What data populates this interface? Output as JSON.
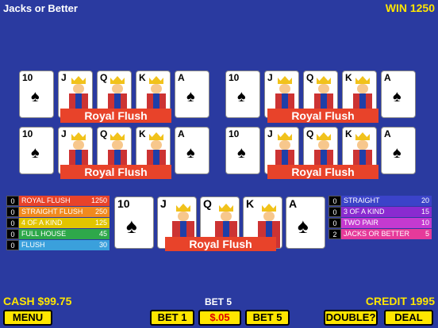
{
  "header": {
    "title": "Jacks or Better",
    "win": "WIN 1250"
  },
  "hands": {
    "banner": "Royal Flush",
    "cards": [
      {
        "rank": "10",
        "suit": "♠"
      },
      {
        "rank": "J",
        "suit": "♠"
      },
      {
        "rank": "Q",
        "suit": "♠"
      },
      {
        "rank": "K",
        "suit": "♠"
      },
      {
        "rank": "A",
        "suit": "♠"
      }
    ]
  },
  "paytable_left": [
    {
      "count": "0",
      "label": "ROYAL FLUSH",
      "value": "1250",
      "color": "#e8432a"
    },
    {
      "count": "0",
      "label": "STRAIGHT FLUSH",
      "value": "250",
      "color": "#f08a1f"
    },
    {
      "count": "0",
      "label": "4 OF A KIND",
      "value": "125",
      "color": "#e2c500"
    },
    {
      "count": "0",
      "label": "FULL HOUSE",
      "value": "45",
      "color": "#2ea84a"
    },
    {
      "count": "0",
      "label": "FLUSH",
      "value": "30",
      "color": "#3aa0dc"
    }
  ],
  "paytable_right": [
    {
      "count": "0",
      "label": "STRAIGHT",
      "value": "20",
      "color": "#3b43c9"
    },
    {
      "count": "0",
      "label": "3 OF A KIND",
      "value": "15",
      "color": "#8a2bd0"
    },
    {
      "count": "0",
      "label": "TWO PAIR",
      "value": "10",
      "color": "#c43ad0"
    },
    {
      "count": "2",
      "label": "JACKS OR BETTER",
      "value": "5",
      "color": "#e63a9a"
    }
  ],
  "footer": {
    "cash": "CASH $99.75",
    "credit": "CREDIT 1995",
    "bet": "BET 5",
    "menu": "MENU",
    "bet1": "BET 1",
    "denom": "$.05",
    "bet5": "BET 5",
    "double": "DOUBLE?",
    "deal": "DEAL"
  }
}
